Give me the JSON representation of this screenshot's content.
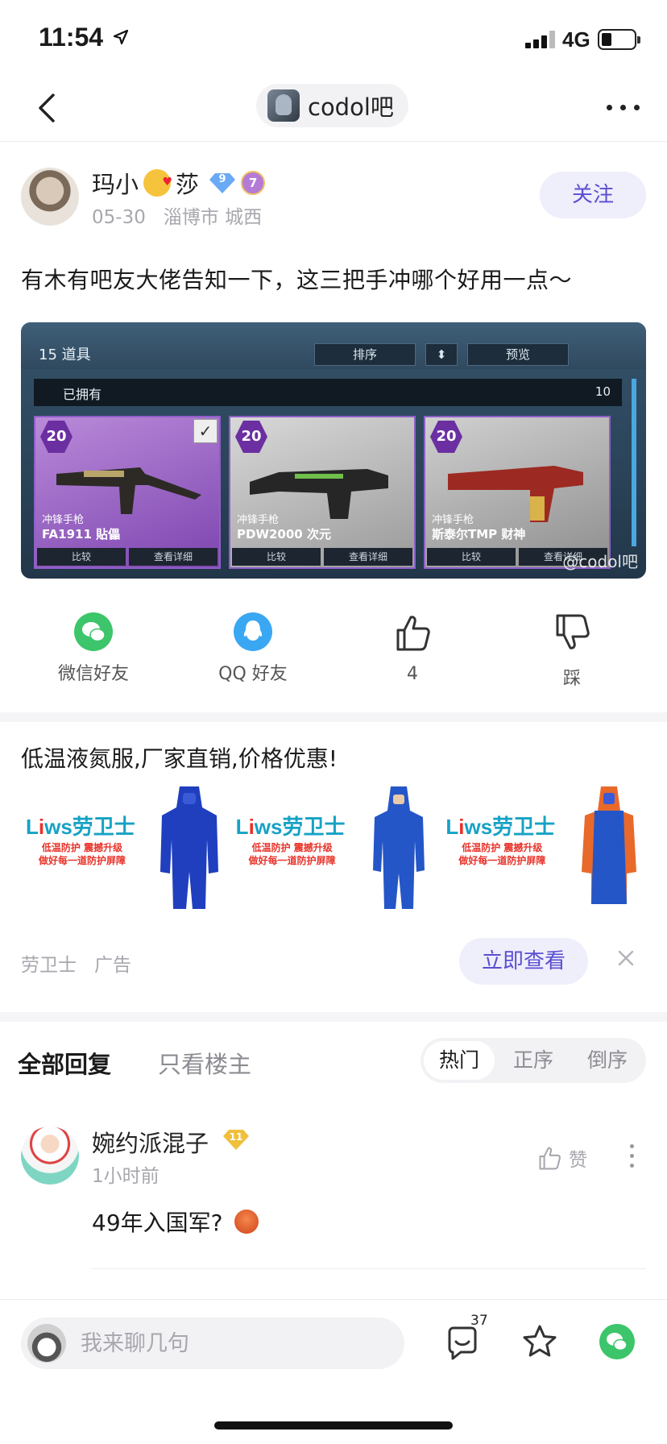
{
  "status_bar": {
    "time": "11:54",
    "network": "4G"
  },
  "nav": {
    "forum_name": "codol吧"
  },
  "post": {
    "author": "玛小",
    "author_suffix": "莎",
    "level_badge": "9",
    "honor_badge": "7",
    "date": "05-30",
    "location": "淄博市 城西",
    "follow_label": "关注",
    "text": "有木有吧友大佬告知一下，这三把手冲哪个好用一点～",
    "image": {
      "section_num": "15",
      "section_title": "道具",
      "sort_label": "排序",
      "preview_label": "预览",
      "owned_label": "已拥有",
      "owned_count": "10",
      "cards": [
        {
          "level": "20",
          "type": "冲锋手枪",
          "name": "FA1911 貼儡",
          "compare": "比较",
          "detail": "查看详细"
        },
        {
          "level": "20",
          "type": "冲锋手枪",
          "name": "PDW2000 次元",
          "compare": "比较",
          "detail": "查看详细"
        },
        {
          "level": "20",
          "type": "冲锋手枪",
          "name": "斯泰尔TMP 财神",
          "compare": "比较",
          "detail": "查看详细"
        }
      ],
      "watermark": "@codol吧"
    }
  },
  "actions": {
    "wechat": "微信好友",
    "qq": "QQ 好友",
    "like_count": "4",
    "dislike": "踩"
  },
  "ad": {
    "title": "低温液氮服,厂家直销,价格优惠!",
    "brand_logo_a": "L",
    "brand_logo_b": "ws劳卫士",
    "brand_logo_i": "i",
    "slogan_1": "低温防护 震撼升级",
    "slogan_2": "做好每一道防护屏障",
    "source": "劳卫士",
    "tag": "广告",
    "cta": "立即查看"
  },
  "replies": {
    "tab_all": "全部回复",
    "tab_op": "只看楼主",
    "sort": [
      "热门",
      "正序",
      "倒序"
    ],
    "comment": {
      "user": "婉约派混子",
      "level": "11",
      "time": "1小时前",
      "like_label": "赞",
      "text": "49年入国军?"
    }
  },
  "bottom": {
    "input_placeholder": "我来聊几句",
    "reply_count": "37"
  }
}
